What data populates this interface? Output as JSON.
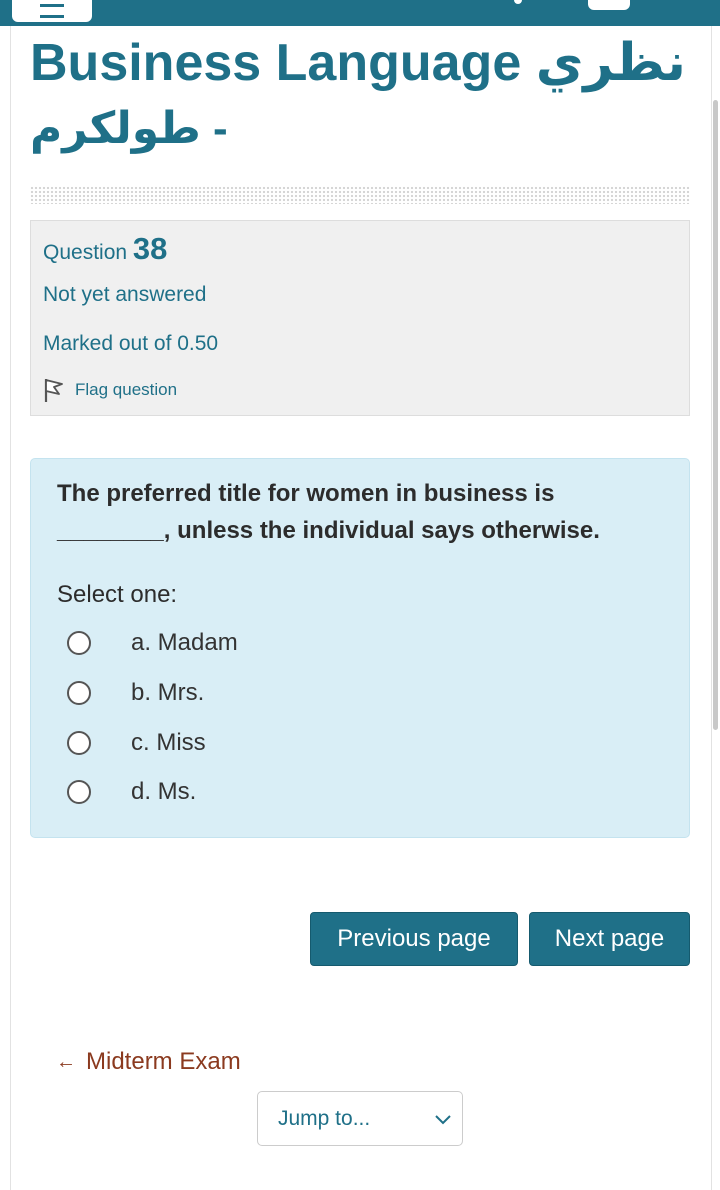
{
  "header": {
    "menu_icon": "hamburger-menu-icon",
    "user_icon": "user-menu-icon"
  },
  "course": {
    "title_line1": "Business Language نظري",
    "title_line2": "- طولكرم"
  },
  "question_info": {
    "label": "Question",
    "number": "38",
    "state": "Not yet answered",
    "grade": "Marked out of 0.50",
    "flag_label": "Flag question"
  },
  "question": {
    "text": "The preferred title for women in business is ________, unless the individual says otherwise.",
    "prompt": "Select one:",
    "options": [
      {
        "label": "a. Madam"
      },
      {
        "label": "b. Mrs."
      },
      {
        "label": "c. Miss"
      },
      {
        "label": "d. Ms."
      }
    ]
  },
  "navigation": {
    "previous_label": "Previous page",
    "next_label": "Next page",
    "back_link_label": "Midterm Exam",
    "jump_placeholder": "Jump to..."
  },
  "colors": {
    "primary": "#1f7088",
    "question_bg": "#d9eef6",
    "info_bg": "#f0f0f0",
    "link_brown": "#8b3a1f"
  }
}
